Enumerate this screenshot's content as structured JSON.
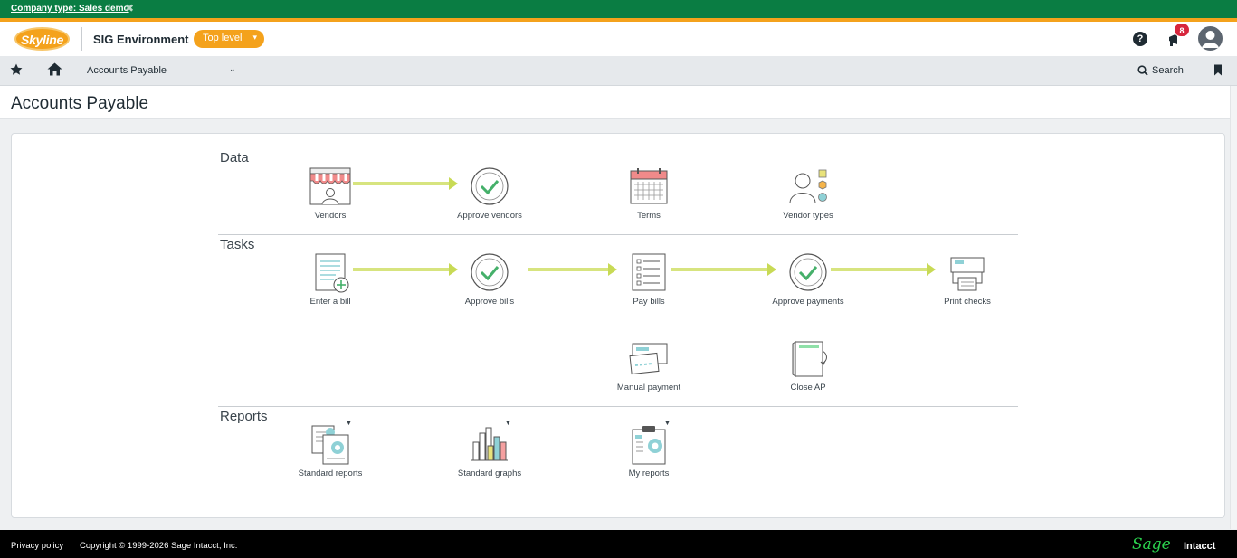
{
  "company_bar": {
    "label": "Company type: Sales demo",
    "close_glyph": "✖"
  },
  "header": {
    "logo_text": "Skyline",
    "environment": "SIG Environment",
    "level_button": "Top level",
    "help_glyph": "?",
    "notification_count": "8"
  },
  "nav": {
    "module": "Accounts Payable",
    "search_label": "Search"
  },
  "page": {
    "title": "Accounts Payable"
  },
  "sections": {
    "data": "Data",
    "tasks": "Tasks",
    "reports": "Reports"
  },
  "tiles": {
    "vendors": "Vendors",
    "approve_vendors": "Approve vendors",
    "terms": "Terms",
    "vendor_types": "Vendor types",
    "enter_bill": "Enter a bill",
    "approve_bills": "Approve bills",
    "pay_bills": "Pay bills",
    "approve_payments": "Approve payments",
    "print_checks": "Print checks",
    "manual_payment": "Manual payment",
    "close_ap": "Close AP",
    "standard_reports": "Standard reports",
    "standard_graphs": "Standard graphs",
    "my_reports": "My reports"
  },
  "footer": {
    "privacy": "Privacy policy",
    "copyright": "Copyright © 1999-2026 Sage Intacct, Inc.",
    "brand": "Sage",
    "product": "Intacct"
  },
  "colors": {
    "company_bar": "#0a7d43",
    "accent_orange": "#f4a21c",
    "flow_arrow": "#d7e47f",
    "check_green": "#45b06a",
    "footer_sage": "#2bd34e"
  }
}
